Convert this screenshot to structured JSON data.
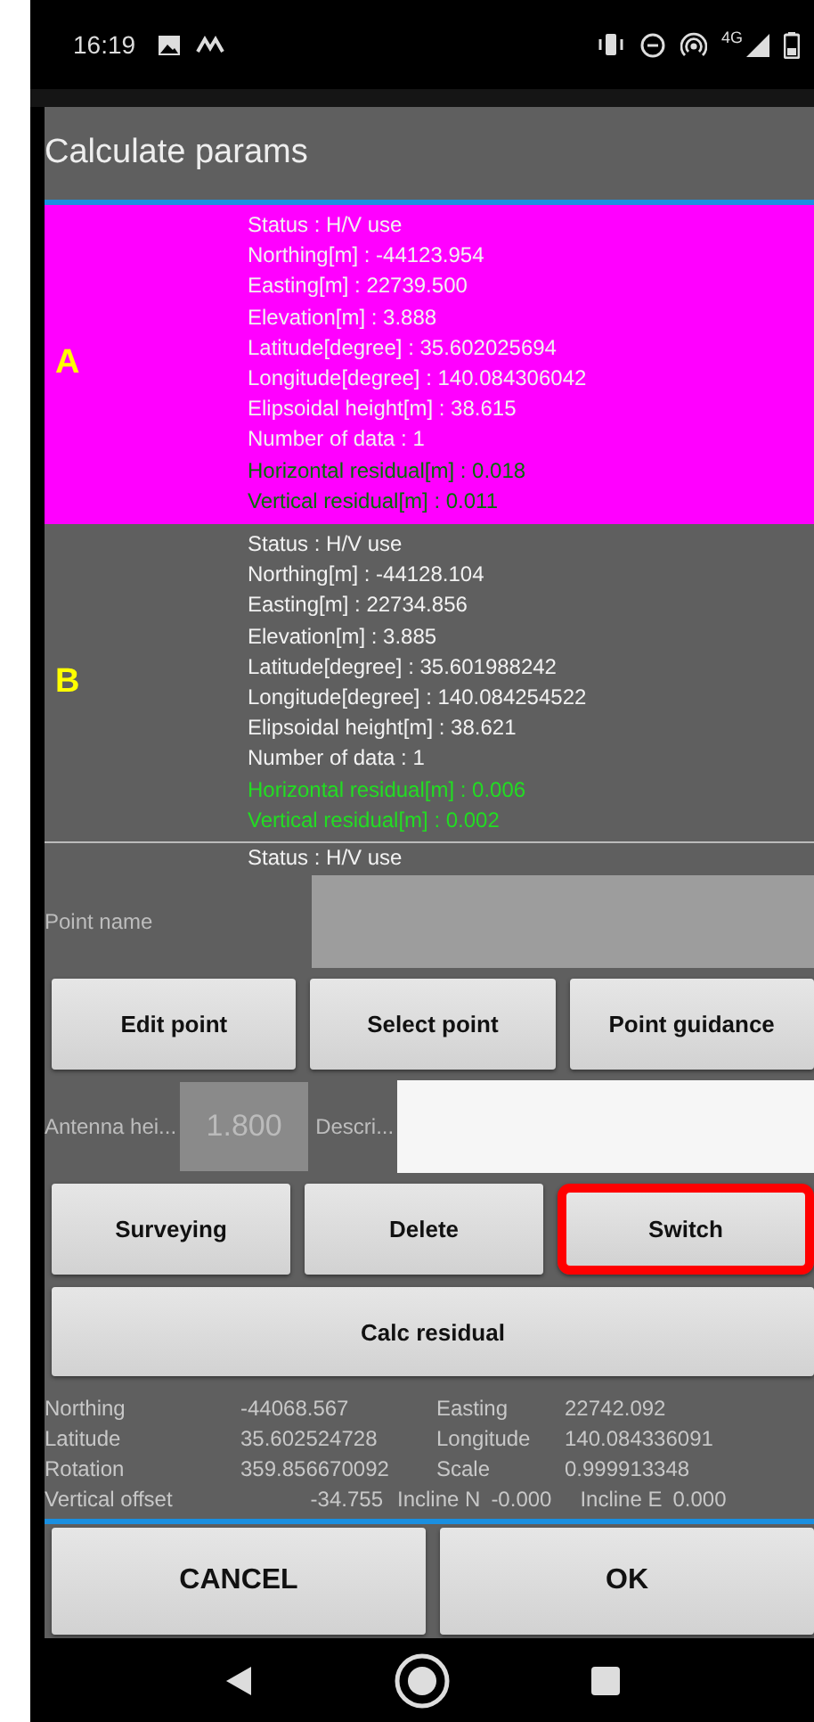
{
  "status_bar": {
    "time": "16:19",
    "network": "4G"
  },
  "dialog": {
    "title": "Calculate params",
    "points": [
      {
        "label": "A",
        "selected": true,
        "lines": [
          {
            "kind": "info",
            "text": "Status : H/V use"
          },
          {
            "kind": "info",
            "text": "Northing[m] : -44123.954"
          },
          {
            "kind": "info",
            "text": "Easting[m] : 22739.500"
          },
          {
            "kind": "info",
            "text": "Elevation[m] : 3.888"
          },
          {
            "kind": "info",
            "text": "Latitude[degree] : 35.602025694"
          },
          {
            "kind": "info",
            "text": "Longitude[degree] : 140.084306042"
          },
          {
            "kind": "info",
            "text": "Elipsoidal height[m] : 38.615"
          },
          {
            "kind": "info",
            "text": "Number of data : 1"
          },
          {
            "kind": "residual",
            "text": "Horizontal residual[m] : 0.018"
          },
          {
            "kind": "residual",
            "text": "Vertical residual[m] : 0.011"
          }
        ]
      },
      {
        "label": "B",
        "selected": false,
        "lines": [
          {
            "kind": "info",
            "text": "Status : H/V use"
          },
          {
            "kind": "info",
            "text": "Northing[m] : -44128.104"
          },
          {
            "kind": "info",
            "text": "Easting[m] : 22734.856"
          },
          {
            "kind": "info",
            "text": "Elevation[m] : 3.885"
          },
          {
            "kind": "info",
            "text": "Latitude[degree] : 35.601988242"
          },
          {
            "kind": "info",
            "text": "Longitude[degree] : 140.084254522"
          },
          {
            "kind": "info",
            "text": "Elipsoidal height[m] : 38.621"
          },
          {
            "kind": "info",
            "text": "Number of data : 1"
          },
          {
            "kind": "residual",
            "text": "Horizontal residual[m] : 0.006"
          },
          {
            "kind": "residual",
            "text": "Vertical residual[m] : 0.002"
          }
        ]
      },
      {
        "selected": false,
        "lines": [
          {
            "kind": "info",
            "text": "Status : H/V use"
          }
        ]
      }
    ],
    "point_name": {
      "label": "Point name"
    },
    "buttons_row_1": [
      {
        "label": "Edit point",
        "highlighted": false
      },
      {
        "label": "Select point",
        "highlighted": false
      },
      {
        "label": "Point guidance",
        "highlighted": false
      }
    ],
    "antenna_height": {
      "label": "Antenna hei...",
      "value": "1.800"
    },
    "description": {
      "label": "Descri..."
    },
    "buttons_row_2": [
      {
        "label": "Surveying",
        "highlighted": false
      },
      {
        "label": "Delete",
        "highlighted": false
      },
      {
        "label": "Switch",
        "highlighted": true
      }
    ],
    "calc_button": "Calc residual",
    "results": [
      [
        "Northing",
        "-44068.567",
        "Easting",
        "22742.092"
      ],
      [
        "Latitude",
        "35.602524728",
        "Longitude",
        "140.084336091"
      ],
      [
        "Rotation",
        "359.856670092",
        "Scale",
        "0.999913348"
      ],
      [
        "Vertical offset",
        "-34.755",
        "Incline N",
        "-0.000",
        "Incline E",
        "0.000"
      ]
    ],
    "actions": [
      "CANCEL",
      "OK"
    ]
  }
}
